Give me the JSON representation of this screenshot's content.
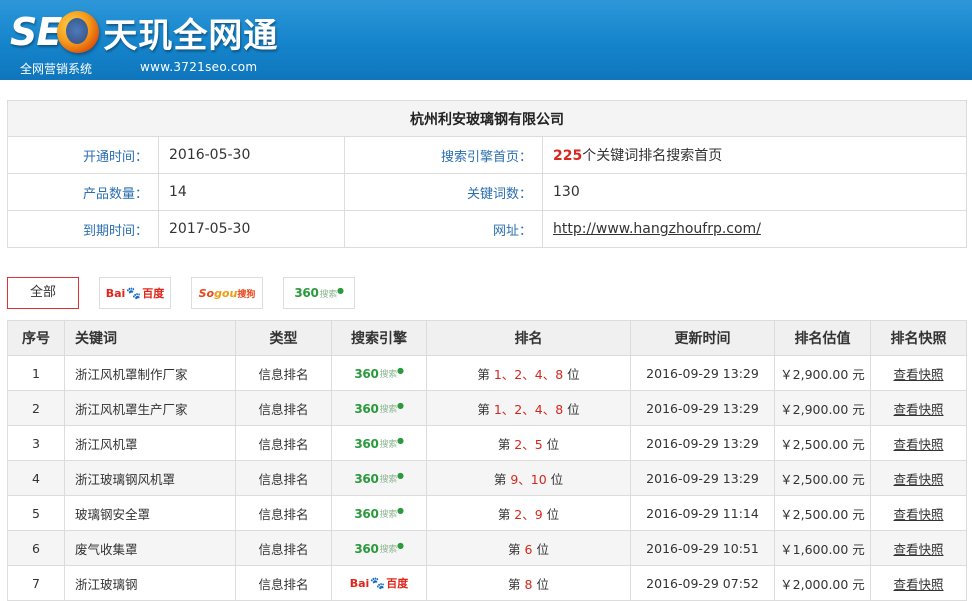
{
  "header": {
    "logo_seo": "SE",
    "logo_cn": "天玑全网通",
    "subtitle": "全网营销系统",
    "site": "www.3721seo.com"
  },
  "info": {
    "company": "杭州利安玻璃钢有限公司",
    "open_label": "开通时间：",
    "open_value": "2016-05-30",
    "engine_home_label": "搜索引擎首页：",
    "engine_home_count": "225",
    "engine_home_text": "个关键词排名搜索首页",
    "products_label": "产品数量：",
    "products_value": "14",
    "keywords_label": "关键词数：",
    "keywords_value": "130",
    "expire_label": "到期时间：",
    "expire_value": "2017-05-30",
    "url_label": "网址：",
    "url_value": "http://www.hangzhoufrp.com/"
  },
  "filters": {
    "all": "全部",
    "baidu": {
      "a": "Bai",
      "paw": "🐾",
      "b": "百度"
    },
    "sogou": {
      "a": "So",
      "b": "gou",
      "c": "搜狗"
    },
    "so360": {
      "a": "360",
      "b": "搜索"
    }
  },
  "table": {
    "headers": {
      "no": "序号",
      "keyword": "关键词",
      "type": "类型",
      "engine": "搜索引擎",
      "rank": "排名",
      "updated": "更新时间",
      "value": "排名估值",
      "snapshot": "排名快照"
    },
    "rows": [
      {
        "no": "1",
        "keyword": "浙江风机罩制作厂家",
        "type": "信息排名",
        "engine": "360",
        "rank_pre": "第 ",
        "rank": "1、2、4、8",
        "rank_post": " 位",
        "updated": "2016-09-29 13:29",
        "value": "￥2,900.00 元",
        "snapshot": "查看快照"
      },
      {
        "no": "2",
        "keyword": "浙江风机罩生产厂家",
        "type": "信息排名",
        "engine": "360",
        "rank_pre": "第 ",
        "rank": "1、2、4、8",
        "rank_post": " 位",
        "updated": "2016-09-29 13:29",
        "value": "￥2,900.00 元",
        "snapshot": "查看快照"
      },
      {
        "no": "3",
        "keyword": "浙江风机罩",
        "type": "信息排名",
        "engine": "360",
        "rank_pre": "第 ",
        "rank": "2、5",
        "rank_post": " 位",
        "updated": "2016-09-29 13:29",
        "value": "￥2,500.00 元",
        "snapshot": "查看快照"
      },
      {
        "no": "4",
        "keyword": "浙江玻璃钢风机罩",
        "type": "信息排名",
        "engine": "360",
        "rank_pre": "第 ",
        "rank": "9、10",
        "rank_post": " 位",
        "updated": "2016-09-29 13:29",
        "value": "￥2,500.00 元",
        "snapshot": "查看快照"
      },
      {
        "no": "5",
        "keyword": "玻璃钢安全罩",
        "type": "信息排名",
        "engine": "360",
        "rank_pre": "第 ",
        "rank": "2、9",
        "rank_post": " 位",
        "updated": "2016-09-29 11:14",
        "value": "￥2,500.00 元",
        "snapshot": "查看快照"
      },
      {
        "no": "6",
        "keyword": "废气收集罩",
        "type": "信息排名",
        "engine": "360",
        "rank_pre": "第 ",
        "rank": "6",
        "rank_post": " 位",
        "updated": "2016-09-29 10:51",
        "value": "￥1,600.00 元",
        "snapshot": "查看快照"
      },
      {
        "no": "7",
        "keyword": "浙江玻璃钢",
        "type": "信息排名",
        "engine": "baidu",
        "rank_pre": "第 ",
        "rank": "8",
        "rank_post": " 位",
        "updated": "2016-09-29 07:52",
        "value": "￥2,000.00 元",
        "snapshot": "查看快照"
      }
    ]
  }
}
